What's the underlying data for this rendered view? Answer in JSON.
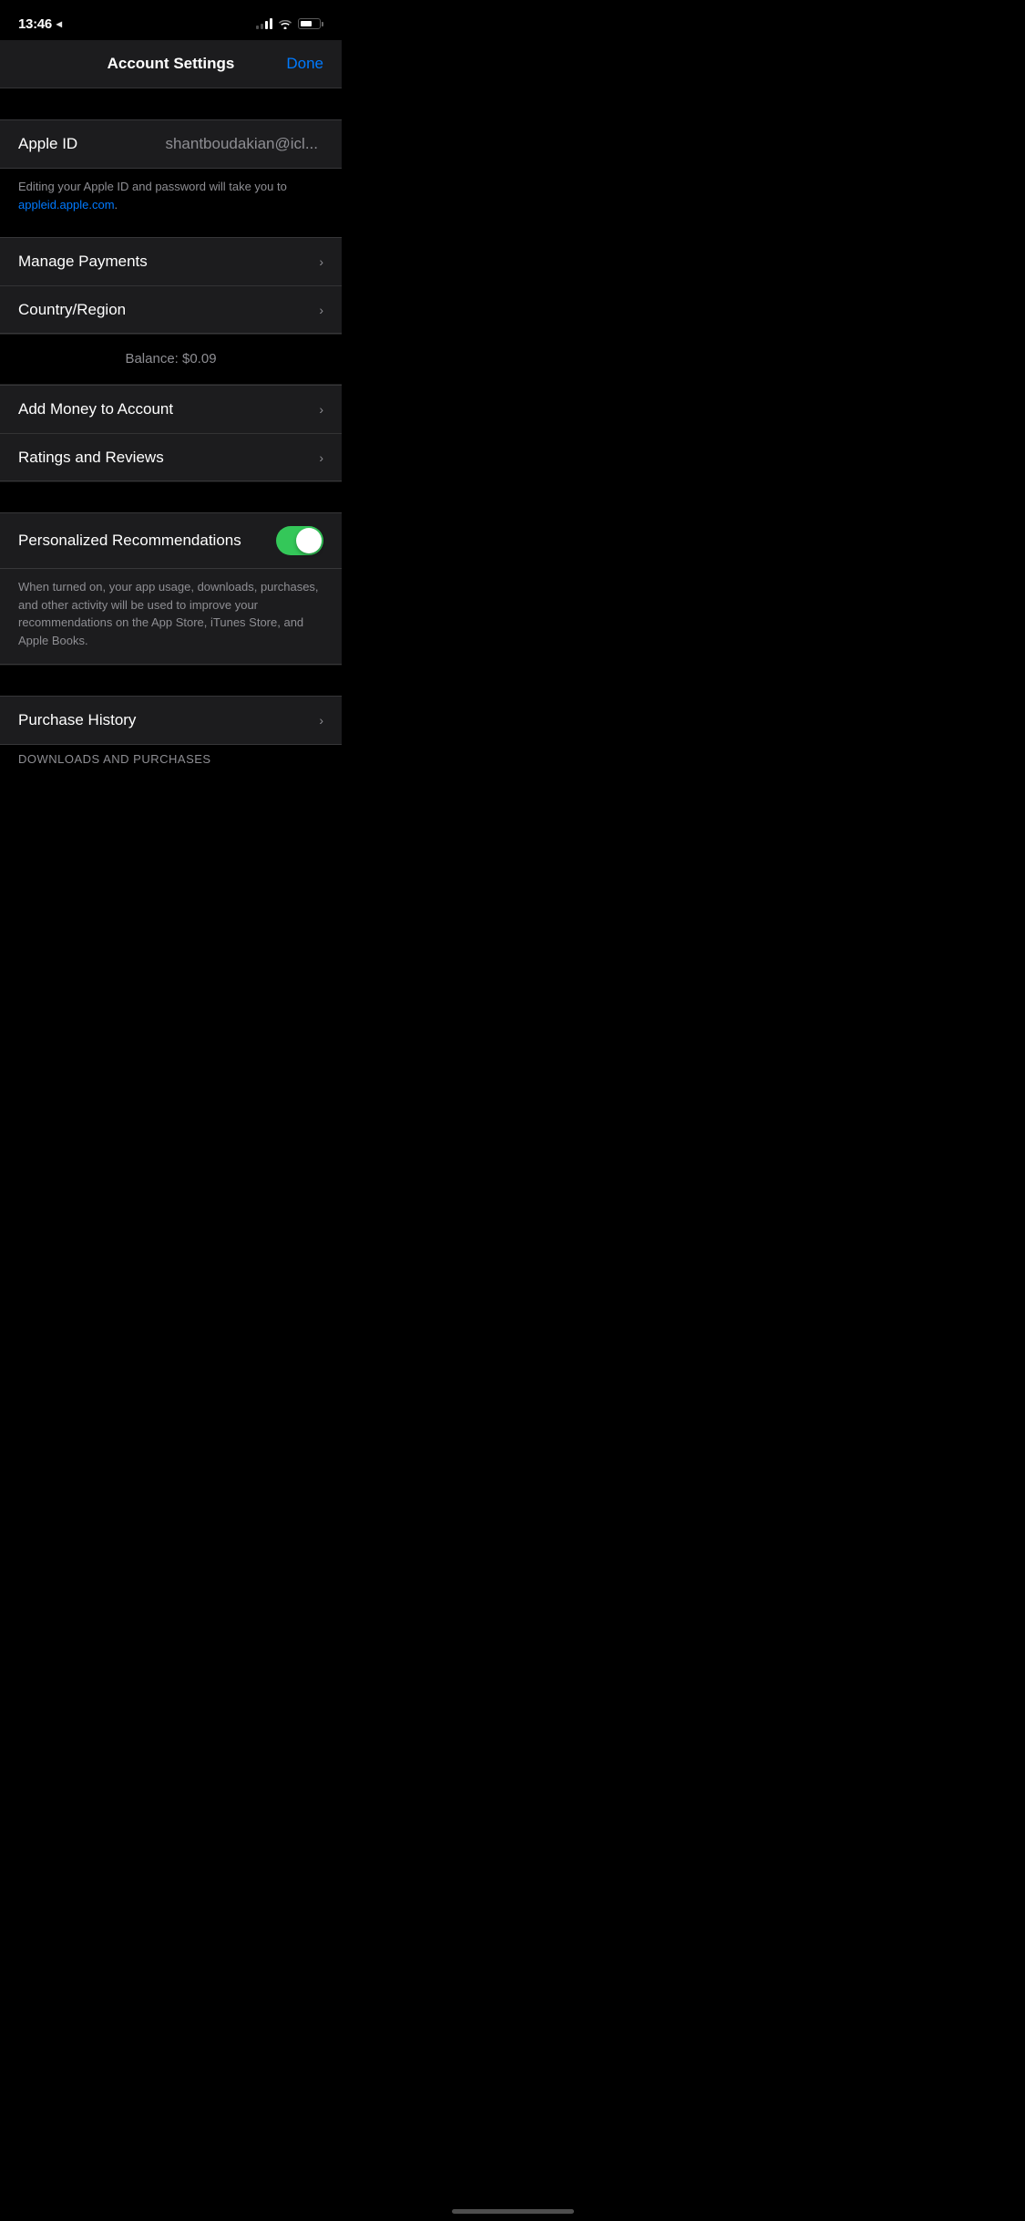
{
  "statusBar": {
    "time": "13:46",
    "locationIcon": "◂",
    "batteryLevel": 65
  },
  "header": {
    "title": "Account Settings",
    "doneLabel": "Done"
  },
  "appleId": {
    "label": "Apple ID",
    "value": "shantboudakian@icl...",
    "description1": "Editing your Apple ID and password will take you to ",
    "link": "appleid.apple.com",
    "description2": "."
  },
  "menuItems": [
    {
      "label": "Manage Payments",
      "hasChevron": true
    },
    {
      "label": "Country/Region",
      "hasChevron": true
    }
  ],
  "balance": {
    "label": "Balance: $0.09"
  },
  "balanceItems": [
    {
      "label": "Add Money to Account",
      "hasChevron": true
    },
    {
      "label": "Ratings and Reviews",
      "hasChevron": true
    }
  ],
  "recommendations": {
    "label": "Personalized Recommendations",
    "enabled": true,
    "description": "When turned on, your app usage, downloads, purchases, and other activity will be used to improve your recommendations on the App Store, iTunes Store, and Apple Books."
  },
  "bottomItems": [
    {
      "label": "Purchase History",
      "hasChevron": true
    }
  ],
  "bottomSectionLabel": "DOWNLOADS AND PURCHASES"
}
